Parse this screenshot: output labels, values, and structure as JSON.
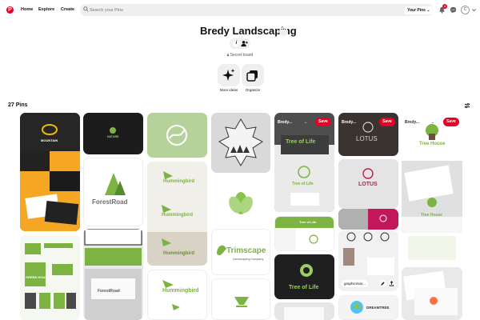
{
  "header": {
    "logo": "P",
    "nav": [
      "Home",
      "Explore",
      "Create"
    ],
    "search_placeholder": "Search your Pins",
    "scope_label": "Your Pins",
    "notification_count": "4",
    "avatar_initial": "C",
    "icons": [
      "search-icon",
      "chevron-down-icon",
      "bell-icon",
      "chat-icon",
      "chevron-down-icon"
    ]
  },
  "board": {
    "title": "Bredy Landscaping",
    "collaborator_initial": "i",
    "privacy": "Secret board",
    "actions": [
      {
        "label": "More ideas",
        "icon": "sparkle-icon"
      },
      {
        "label": "Organize",
        "icon": "organize-icon"
      }
    ]
  },
  "pins": {
    "count_label": "27 Pins",
    "save_label": "Save",
    "card_titles": [
      "Bredy...",
      "Bredy...",
      "Bredy..."
    ],
    "link_chip": "graphicriver...",
    "logo_texts": {
      "mountain": "MOUNTAIN",
      "natures": "NATURE",
      "forestroad": "ForestRoad",
      "forestroad_small": "ForestRoad",
      "hummingbird": "Hummingbird",
      "trimscape": "Trimscape",
      "trimscape_sub": "Landscaping Company",
      "treeoflife": "Tree of Life",
      "lotus": "LOTUS",
      "treehouse": "Tree House",
      "greenhouse": "GREEN HOUSE",
      "dreamtree": "DREAMTREE"
    }
  },
  "colors": {
    "brand_red": "#e60023",
    "chip_bg": "#efefef",
    "leaf_green": "#7cb342"
  }
}
